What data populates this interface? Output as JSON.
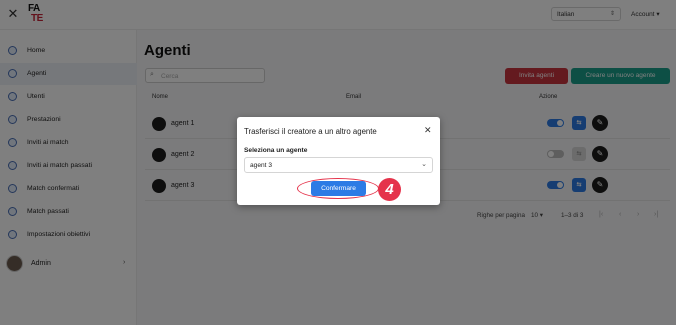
{
  "topbar": {
    "logo_line1": "FA",
    "logo_line2": "TE",
    "language": "Italian",
    "account_label": "Account"
  },
  "sidebar": {
    "items": [
      {
        "label": "Home",
        "icon": "home-icon"
      },
      {
        "label": "Agenti",
        "icon": "agent-icon",
        "active": true
      },
      {
        "label": "Utenti",
        "icon": "users-icon"
      },
      {
        "label": "Prestazioni",
        "icon": "performance-icon"
      },
      {
        "label": "Inviti ai match",
        "icon": "invite-icon"
      },
      {
        "label": "Inviti ai match passati",
        "icon": "past-invite-icon"
      },
      {
        "label": "Match confermati",
        "icon": "confirmed-icon"
      },
      {
        "label": "Match passati",
        "icon": "past-match-icon"
      },
      {
        "label": "Impostazioni obiettivi",
        "icon": "settings-icon"
      }
    ],
    "user_label": "Admin"
  },
  "main": {
    "title": "Agenti",
    "search_placeholder": "Cerca",
    "invite_button": "Invita agenti",
    "create_button": "Creare un nuovo agente",
    "columns": {
      "name": "Nome",
      "email": "Email",
      "action": "Azione"
    },
    "rows": [
      {
        "name": "agent 1",
        "toggle_on": true
      },
      {
        "name": "agent 2",
        "toggle_on": false
      },
      {
        "name": "agent 3",
        "toggle_on": true
      }
    ],
    "transfer_icon_text": "⇆",
    "pagination": {
      "rows_per_page_label": "Righe per pagina",
      "rows_per_page": "10",
      "range": "1–3 di 3"
    }
  },
  "dialog": {
    "title": "Trasferisci il creatore a un altro agente",
    "select_label": "Seleziona un agente",
    "selected_agent": "agent 3",
    "confirm_button": "Confermare",
    "step_number": "4"
  },
  "colors": {
    "accent_blue": "#2c7be5",
    "invite_red": "#c8343f",
    "create_teal": "#1a9e8a",
    "highlight_red": "#e5334b"
  }
}
